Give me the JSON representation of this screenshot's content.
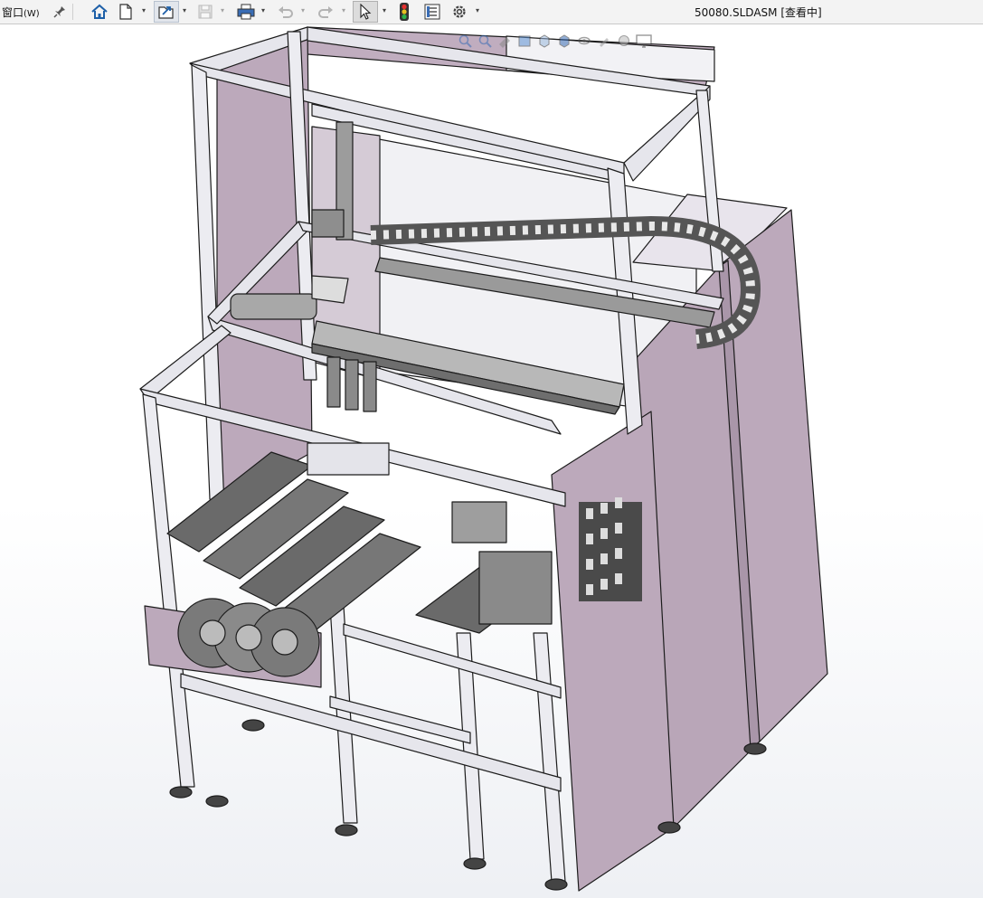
{
  "menu": {
    "window_label": "窗口",
    "window_accel": "(W)"
  },
  "document": {
    "title": "50080.SLDASM [查看中]"
  },
  "toolbar": {
    "icons": [
      "pin-icon",
      "home-icon",
      "new-document-icon",
      "open-document-icon",
      "save-icon",
      "print-icon",
      "undo-icon",
      "redo-icon",
      "select-arrow-icon",
      "traffic-light-icon",
      "file-properties-icon",
      "options-gear-icon"
    ]
  },
  "heads_up": {
    "icons": [
      "zoom-to-fit-icon",
      "zoom-to-area-icon",
      "previous-view-icon",
      "section-view-icon",
      "view-orientation-icon",
      "display-style-icon",
      "hide-show-icon",
      "edit-appearance-icon",
      "apply-scene-icon",
      "view-settings-icon"
    ]
  },
  "colors": {
    "panel": "#bca9bb",
    "panel_dark": "#a996a9",
    "frame": "#e6e6ec",
    "edge": "#1c1c1c",
    "metal": "#8a8a8a",
    "metal_dark": "#4a4a4a",
    "toolbar_bg": "#f3f3f3"
  }
}
